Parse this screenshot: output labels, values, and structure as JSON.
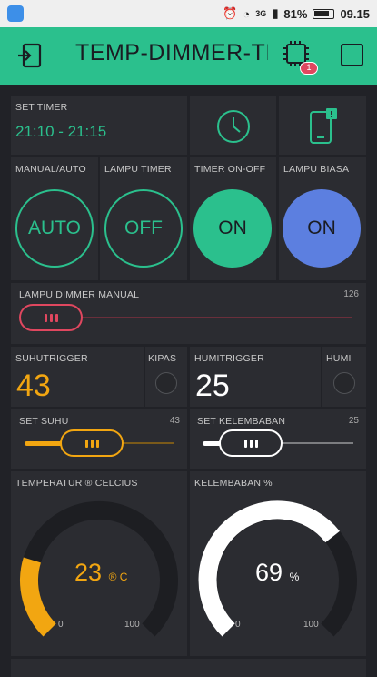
{
  "status_bar": {
    "battery": "81%",
    "time": "09.15",
    "network": "3G"
  },
  "header": {
    "title": "TEMP-DIMMER-TIMER",
    "notification_count": "1",
    "accent": "#2bc08d"
  },
  "set_timer": {
    "label": "SET TIMER",
    "value": "21:10 - 21:15"
  },
  "buttons": [
    {
      "label": "MANUAL/AUTO",
      "state": "AUTO",
      "style": "outline"
    },
    {
      "label": "LAMPU TIMER",
      "state": "OFF",
      "style": "outline"
    },
    {
      "label": "TIMER ON-OFF",
      "state": "ON",
      "style": "filled",
      "color": "#2bc08d"
    },
    {
      "label": "LAMPU BIASA",
      "state": "ON",
      "style": "filled",
      "color": "#5c7fe0"
    }
  ],
  "dimmer": {
    "label": "LAMPU DIMMER MANUAL",
    "value": "126",
    "color": "#e0475f"
  },
  "suhu_trigger": {
    "label": "SUHUTRIGGER",
    "value": "43",
    "color": "#f2a611"
  },
  "kipas": {
    "label": "KIPAS"
  },
  "humi_trigger": {
    "label": "HUMITRIGGER",
    "value": "25",
    "color": "#ffffff"
  },
  "humi": {
    "label": "HUMI"
  },
  "set_suhu": {
    "label": "SET SUHU",
    "value": "43",
    "color": "#f2a611"
  },
  "set_kelembaban": {
    "label": "SET KELEMBABAN",
    "value": "25",
    "color": "#ffffff"
  },
  "gauge_temp": {
    "label": "TEMPERATUR ® CELCIUS",
    "value": "23",
    "unit": "® C",
    "min": "0",
    "max": "100",
    "fraction": 0.23,
    "color": "#f2a611"
  },
  "gauge_humi": {
    "label": "KELEMBABAN %",
    "value": "69",
    "unit": "%",
    "min": "0",
    "max": "100",
    "fraction": 0.69,
    "color": "#ffffff"
  }
}
